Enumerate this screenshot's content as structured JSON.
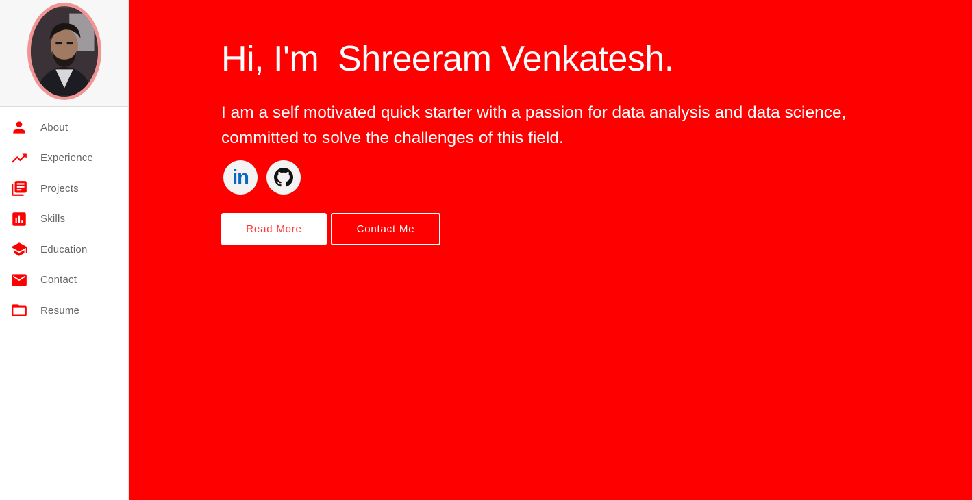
{
  "sidebar": {
    "avatar_icon": "profile-photo",
    "items": [
      {
        "label": "About",
        "icon": "person-icon"
      },
      {
        "label": "Experience",
        "icon": "trending-up-icon"
      },
      {
        "label": "Projects",
        "icon": "library-books-icon"
      },
      {
        "label": "Skills",
        "icon": "bar-chart-icon"
      },
      {
        "label": "Education",
        "icon": "school-icon"
      },
      {
        "label": "Contact",
        "icon": "mail-icon"
      },
      {
        "label": "Resume",
        "icon": "folder-icon"
      }
    ]
  },
  "hero": {
    "headline": "Hi, I'm  Shreeram Venkatesh.",
    "intro": "I am a self motivated quick starter with a passion for data analysis and data science, committed to solve the challenges of this field.",
    "socials": [
      {
        "name": "LinkedIn",
        "icon": "linkedin-icon",
        "text": "in"
      },
      {
        "name": "GitHub",
        "icon": "github-icon"
      }
    ],
    "read_more_label": "Read More",
    "contact_label": "Contact Me"
  },
  "colors": {
    "accent": "#ff0000",
    "avatar_border": "#f19494",
    "nav_text": "#666666"
  }
}
